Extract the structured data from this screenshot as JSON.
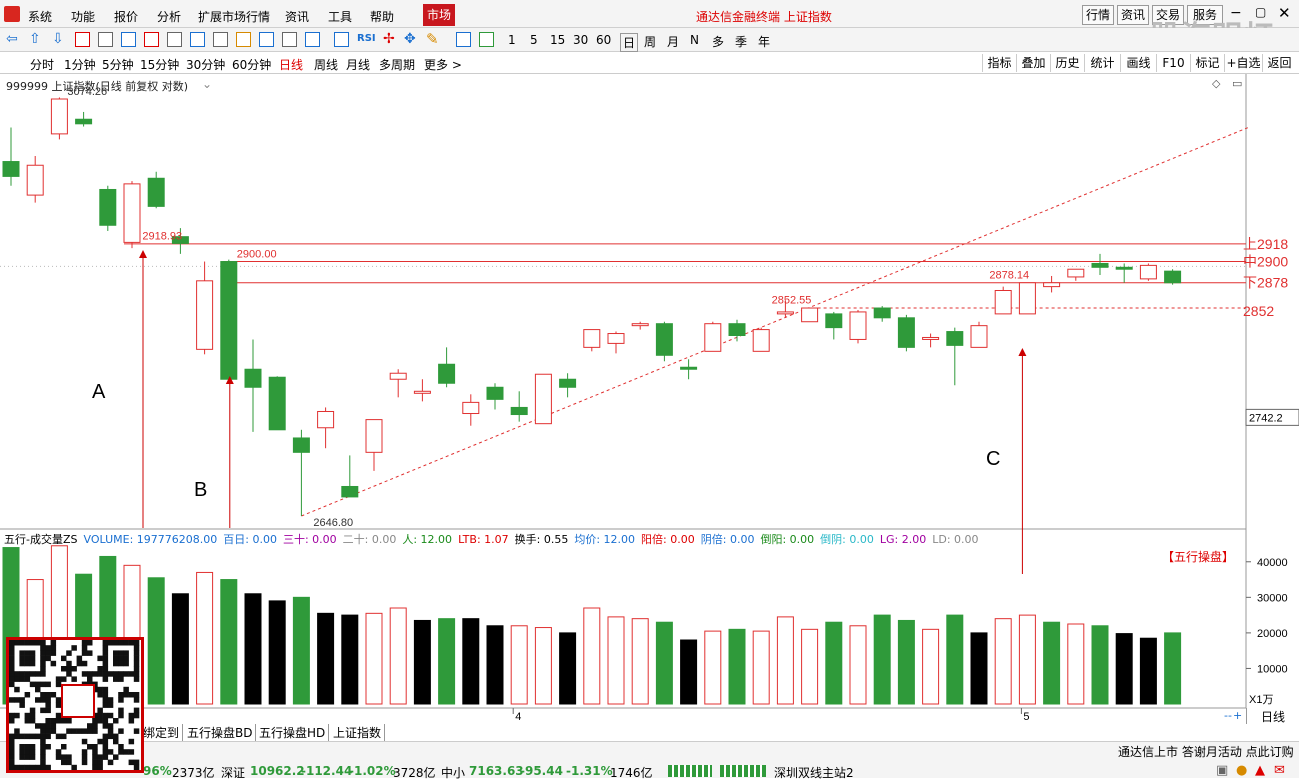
{
  "menubar": {
    "items": [
      "系统",
      "功能",
      "报价",
      "分析",
      "扩展市场行情",
      "资讯",
      "工具",
      "帮助"
    ],
    "market": "市场",
    "title": "通达信金融终端 上证指数",
    "right_buttons": [
      "行情",
      "资讯",
      "交易",
      "服务"
    ]
  },
  "watermark": "股海明灯",
  "toolbar": {
    "periods": [
      "1",
      "5",
      "15",
      "30",
      "60"
    ],
    "cycles": [
      "日",
      "周",
      "月",
      "N",
      "多",
      "季",
      "年"
    ]
  },
  "periodbar": {
    "items": [
      "分时",
      "1分钟",
      "5分钟",
      "15分钟",
      "30分钟",
      "60分钟",
      "日线",
      "周线",
      "月线",
      "多周期",
      "更多 >"
    ],
    "active": "日线",
    "right_items": [
      "指标",
      "叠加",
      "历史",
      "统计",
      "画线",
      "F10",
      "标记",
      "+自选",
      "返回"
    ]
  },
  "chart_info": "999999 上证指数(日线 前复权 对数)",
  "colors": {
    "up": "#e03030",
    "down": "#2f9a3a",
    "black": "#000000",
    "accent": "#c8171e"
  },
  "chart_data": {
    "type": "candlestick",
    "candles": [
      {
        "o": 3006,
        "h": 3043,
        "l": 2980,
        "c": 2990
      },
      {
        "o": 2970,
        "h": 3012,
        "l": 2962,
        "c": 3002
      },
      {
        "o": 3036,
        "h": 3076,
        "l": 3030,
        "c": 3074.26
      },
      {
        "o": 3052,
        "h": 3060,
        "l": 3044,
        "c": 3047
      },
      {
        "o": 2976,
        "h": 2980,
        "l": 2932,
        "c": 2938
      },
      {
        "o": 2920,
        "h": 2985,
        "l": 2914,
        "c": 2982
      },
      {
        "o": 2988,
        "h": 2995,
        "l": 2956,
        "c": 2958
      },
      {
        "o": 2926,
        "h": 2935,
        "l": 2908,
        "c": 2918.93
      },
      {
        "o": 2810,
        "h": 2900,
        "l": 2805,
        "c": 2880
      },
      {
        "o": 2900,
        "h": 2902,
        "l": 2776,
        "c": 2780
      },
      {
        "o": 2790,
        "h": 2820,
        "l": 2728,
        "c": 2772
      },
      {
        "o": 2782,
        "h": 2783,
        "l": 2740,
        "c": 2730
      },
      {
        "o": 2722,
        "h": 2730,
        "l": 2646.8,
        "c": 2708
      },
      {
        "o": 2732,
        "h": 2752,
        "l": 2712,
        "c": 2748
      },
      {
        "o": 2675,
        "h": 2705,
        "l": 2668,
        "c": 2665
      },
      {
        "o": 2708,
        "h": 2738,
        "l": 2690,
        "c": 2740
      },
      {
        "o": 2780,
        "h": 2790,
        "l": 2762,
        "c": 2786
      },
      {
        "o": 2766,
        "h": 2780,
        "l": 2758,
        "c": 2768
      },
      {
        "o": 2795,
        "h": 2812,
        "l": 2772,
        "c": 2776
      },
      {
        "o": 2746,
        "h": 2765,
        "l": 2734,
        "c": 2757
      },
      {
        "o": 2772,
        "h": 2776,
        "l": 2750,
        "c": 2760
      },
      {
        "o": 2752,
        "h": 2768,
        "l": 2738,
        "c": 2745
      },
      {
        "o": 2736,
        "h": 2785,
        "l": 2736,
        "c": 2785
      },
      {
        "o": 2780,
        "h": 2786,
        "l": 2762,
        "c": 2772
      },
      {
        "o": 2812,
        "h": 2830,
        "l": 2808,
        "c": 2830
      },
      {
        "o": 2816,
        "h": 2828,
        "l": 2806,
        "c": 2826
      },
      {
        "o": 2834,
        "h": 2838,
        "l": 2830,
        "c": 2836
      },
      {
        "o": 2836,
        "h": 2838,
        "l": 2798,
        "c": 2804
      },
      {
        "o": 2792,
        "h": 2800,
        "l": 2780,
        "c": 2790
      },
      {
        "o": 2808,
        "h": 2838,
        "l": 2808,
        "c": 2836
      },
      {
        "o": 2836,
        "h": 2840,
        "l": 2818,
        "c": 2824
      },
      {
        "o": 2808,
        "h": 2832,
        "l": 2808,
        "c": 2830
      },
      {
        "o": 2846,
        "h": 2860,
        "l": 2842,
        "c": 2848
      },
      {
        "o": 2838,
        "h": 2852.55,
        "l": 2838,
        "c": 2852
      },
      {
        "o": 2846,
        "h": 2848,
        "l": 2820,
        "c": 2832
      },
      {
        "o": 2820,
        "h": 2850,
        "l": 2816,
        "c": 2848
      },
      {
        "o": 2852,
        "h": 2854,
        "l": 2838,
        "c": 2842
      },
      {
        "o": 2842,
        "h": 2845,
        "l": 2808,
        "c": 2812
      },
      {
        "o": 2820,
        "h": 2826,
        "l": 2812,
        "c": 2822
      },
      {
        "o": 2828,
        "h": 2832,
        "l": 2774,
        "c": 2814
      },
      {
        "o": 2812,
        "h": 2838,
        "l": 2812,
        "c": 2834
      },
      {
        "o": 2846,
        "h": 2874,
        "l": 2846,
        "c": 2870
      },
      {
        "o": 2846,
        "h": 2878.14,
        "l": 2846,
        "c": 2878
      },
      {
        "o": 2874,
        "h": 2885,
        "l": 2868,
        "c": 2878
      },
      {
        "o": 2884,
        "h": 2892,
        "l": 2880,
        "c": 2892
      },
      {
        "o": 2898,
        "h": 2908,
        "l": 2886,
        "c": 2894
      },
      {
        "o": 2894,
        "h": 2898,
        "l": 2878,
        "c": 2892
      },
      {
        "o": 2882,
        "h": 2898,
        "l": 2880,
        "c": 2896
      },
      {
        "o": 2890,
        "h": 2892,
        "l": 2876,
        "c": 2878
      }
    ],
    "volume": [
      44000,
      35000,
      44500,
      36500,
      41500,
      39000,
      35500,
      31000,
      37000,
      35000,
      31000,
      29000,
      30000,
      25500,
      25000,
      25500,
      27000,
      23500,
      24000,
      24000,
      22000,
      22000,
      21500,
      20000,
      27000,
      24500,
      24000,
      23000,
      18000,
      20500,
      21000,
      20500,
      24500,
      21000,
      23000,
      22000,
      25000,
      23500,
      21000,
      25000,
      20000,
      24000,
      25000,
      23000,
      22500,
      22000,
      19800,
      18500,
      20000
    ],
    "volume_color": [
      "down",
      "up",
      "up",
      "down",
      "down",
      "up",
      "down",
      "black",
      "up",
      "down",
      "black",
      "black",
      "down",
      "black",
      "black",
      "up",
      "up",
      "black",
      "down",
      "black",
      "black",
      "up",
      "up",
      "black",
      "up",
      "up",
      "up",
      "down",
      "black",
      "up",
      "down",
      "up",
      "up",
      "up",
      "down",
      "up",
      "down",
      "down",
      "up",
      "down",
      "black",
      "up",
      "up",
      "down",
      "up",
      "down",
      "black",
      "black",
      "down"
    ],
    "price_labels": [
      {
        "i": 2,
        "p": 3074.26,
        "label": "3074.26",
        "side": "right"
      },
      {
        "i": 7,
        "p": 2918.93,
        "label": "2918.93",
        "side": "left"
      },
      {
        "i": 9,
        "p": 2900,
        "label": "2900.00",
        "side": "right"
      },
      {
        "i": 12,
        "p": 2646.8,
        "label": "2646.80",
        "side": "right"
      },
      {
        "i": 33,
        "p": 2852.55,
        "label": "2852.55",
        "side": "left"
      },
      {
        "i": 42,
        "p": 2878.14,
        "label": "2878.14",
        "side": "left"
      }
    ],
    "hlines": [
      {
        "p": 2918.5,
        "label": "上2918",
        "dash": false
      },
      {
        "p": 2900,
        "label": "中2900",
        "dash": false
      },
      {
        "p": 2878,
        "label": "下2878",
        "dash": false
      },
      {
        "p": 2852,
        "label": "2852",
        "dash": true
      }
    ],
    "trendline": {
      "from": {
        "i": 12,
        "p": 2646.8
      },
      "to": {
        "i": 33,
        "p": 2852.55
      },
      "extend_to": 2918
    },
    "annotations": [
      {
        "text": "A",
        "i": 5
      },
      {
        "text": "B",
        "i": 9
      },
      {
        "text": "C",
        "i": 42
      }
    ],
    "price_axis_label": "2742.2",
    "vol_ticks": [
      "40000",
      "30000",
      "20000",
      "10000"
    ],
    "vol_unit": "X1万",
    "x_ticks": [
      {
        "i": 21,
        "label": "4"
      },
      {
        "i": 42,
        "label": "5"
      }
    ],
    "wuxing_label": "【五行操盘】"
  },
  "volinfo": [
    {
      "t": "五行-成交量ZS",
      "c": "#000"
    },
    {
      "t": "VOLUME: 197776208.00",
      "c": "#1a6fd0"
    },
    {
      "t": "百日: 0.00",
      "c": "#1a6fd0"
    },
    {
      "t": "三十: 0.00",
      "c": "#a000a0"
    },
    {
      "t": "二十: 0.00",
      "c": "#888"
    },
    {
      "t": "人: 12.00",
      "c": "#1a8a1a"
    },
    {
      "t": "LTB: 1.07",
      "c": "#d00"
    },
    {
      "t": "换手: 0.55",
      "c": "#000"
    },
    {
      "t": "均价: 12.00",
      "c": "#1a6fd0"
    },
    {
      "t": "阳倍: 0.00",
      "c": "#d00"
    },
    {
      "t": "阴倍: 0.00",
      "c": "#1a6fd0"
    },
    {
      "t": "倒阳: 0.00",
      "c": "#1a8a1a"
    },
    {
      "t": "倒阴: 0.00",
      "c": "#2ab8c8"
    },
    {
      "t": "LG: 2.00",
      "c": "#a000a0"
    },
    {
      "t": "LD: 0.00",
      "c": "#888"
    }
  ],
  "bottomtabs": [
    "绑定到",
    "五行操盘BD",
    "五行操盘HD",
    "上证指数"
  ],
  "bottom_right_tab": "日线",
  "status": {
    "sh_pct": "96%",
    "sh_amt": "2373亿",
    "sz_label": "深证",
    "sz_val": "10962.2",
    "sz_chg": "-112.44",
    "sz_pct": "-1.02%",
    "sz_amt": "3728亿",
    "zx_label": "中小",
    "zx_val": "7163.63",
    "zx_chg": "-95.44",
    "zx_pct": "-1.31%",
    "zx_amt": "1746亿",
    "server": "深圳双线主站2",
    "notice": "通达信上市 答谢月活动 点此订购"
  }
}
